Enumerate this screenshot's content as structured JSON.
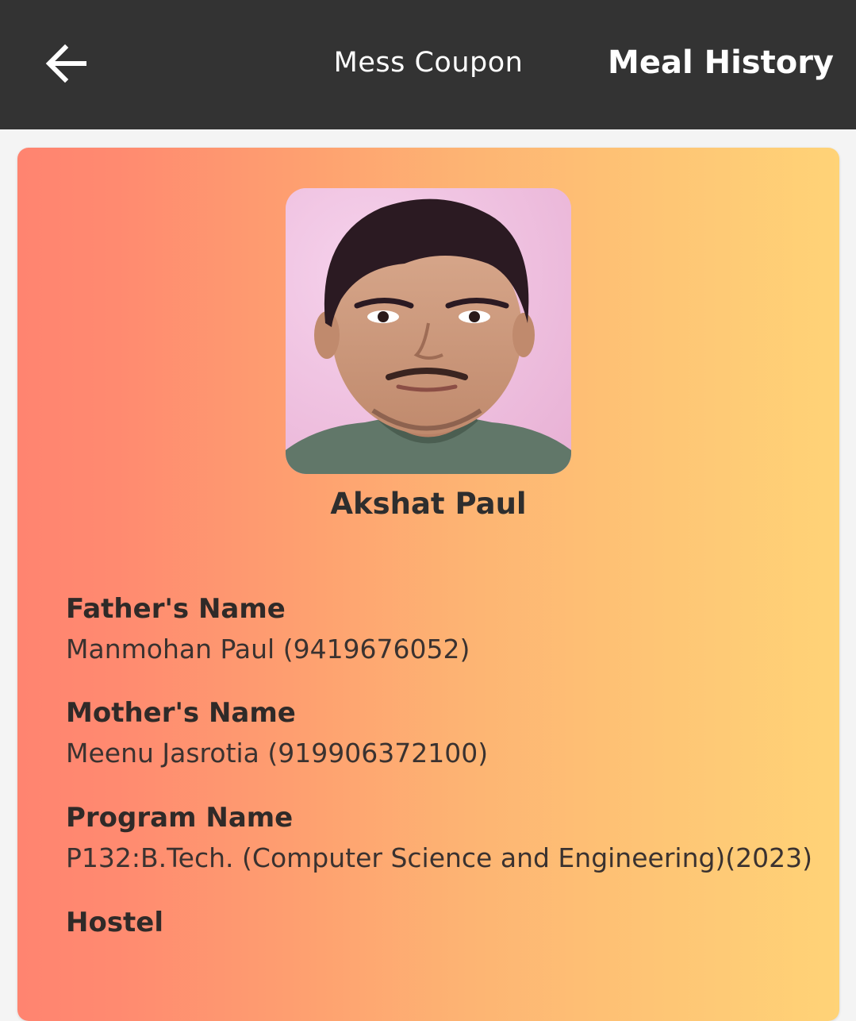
{
  "header": {
    "back_icon": "arrow-left-icon",
    "tabs": [
      {
        "label": "Mess Coupon"
      },
      {
        "label": "Meal History"
      }
    ]
  },
  "profile": {
    "name": "Akshat Paul",
    "photo": "student-photo",
    "colors": {
      "card_gradient_start": "#ff8470",
      "card_gradient_end": "#ffd377",
      "header_bg": "#333333"
    }
  },
  "details": [
    {
      "label": "Father's Name",
      "value": "Manmohan Paul (9419676052)"
    },
    {
      "label": "Mother's Name",
      "value": "Meenu Jasrotia (919906372100)"
    },
    {
      "label": "Program Name",
      "value": "P132:B.Tech. (Computer Science and Engineering)(2023)"
    },
    {
      "label": "Hostel",
      "value": ""
    }
  ]
}
